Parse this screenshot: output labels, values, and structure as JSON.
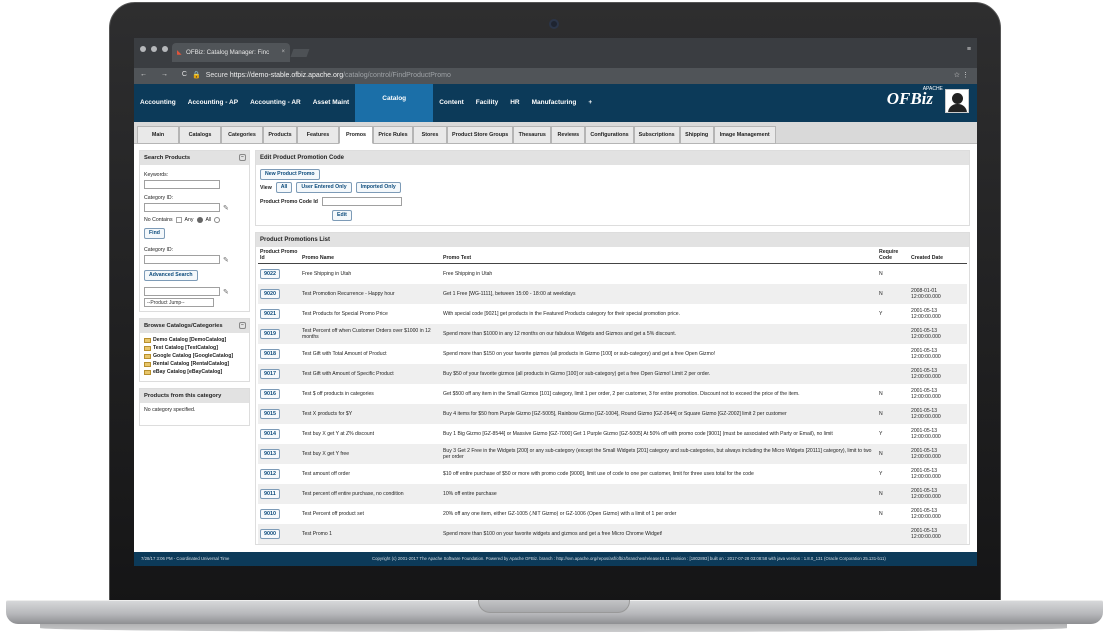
{
  "browser": {
    "tab_title": "OFBiz: Catalog Manager: Finc",
    "secure_label": "Secure",
    "url_host": "https://demo-stable.ofbiz.apache.org",
    "url_path": "/catalog/control/FindProductPromo",
    "nav_glyphs": "← → C"
  },
  "app_nav": {
    "items": [
      "Accounting",
      "Accounting - AP",
      "Accounting - AR",
      "Asset Maint",
      "Catalog",
      "Content",
      "Facility",
      "HR",
      "Manufacturing",
      "+"
    ],
    "selected": "Catalog",
    "logo_text": "OFBiz",
    "logo_small": "APACHE"
  },
  "sub_tabs": {
    "items": [
      "Main",
      "Catalogs",
      "Categories",
      "Products",
      "Features",
      "Promos",
      "Price Rules",
      "Stores",
      "Product Store Groups",
      "Thesaurus",
      "Reviews",
      "Configurations",
      "Subscriptions",
      "Shipping",
      "Image Management"
    ],
    "selected": "Promos"
  },
  "search": {
    "title": "Search Products",
    "keywords_label": "Keywords:",
    "category_label": "Category ID:",
    "no_contains_label": "No Contains",
    "any_label": "Any",
    "all_label": "All",
    "find_label": "Find",
    "category_label2": "Category ID:",
    "advanced_label": "Advanced Search",
    "jump_label": "--Product Jump--"
  },
  "browse": {
    "title": "Browse Catalogs/Categories",
    "items": [
      "Demo Catalog [DemoCatalog]",
      "Test Catalog [TestCatalog]",
      "Google Catalog [GoogleCatalog]",
      "Rental Catalog [RentalCatalog]",
      "eBay Catalog [eBayCatalog]"
    ]
  },
  "products_cat": {
    "title": "Products from this category",
    "empty": "No category specified."
  },
  "edit": {
    "title": "Edit Product Promotion Code",
    "new_label": "New Product Promo",
    "view_label": "View",
    "all_label": "All",
    "user_label": "User Entered Only",
    "imported_label": "Imported Only",
    "code_label": "Product Promo Code Id",
    "edit_label": "Edit"
  },
  "list": {
    "title": "Product Promotions List",
    "headers": {
      "id": "Product Promo Id",
      "name": "Promo Name",
      "text": "Promo Text",
      "req": "Require Code",
      "created": "Created Date"
    },
    "rows": [
      {
        "id": "9022",
        "name": "Free Shipping in Utah",
        "text": "Free Shipping in Utah",
        "req": "N",
        "date": "",
        "time": ""
      },
      {
        "id": "9020",
        "name": "Test Promotion Recurrence - Happy hour",
        "text": "Get 1 Free [WG-1111], between 15:00 - 18:00 at weekdays",
        "req": "N",
        "date": "2008-01-01",
        "time": "12:00:00.000"
      },
      {
        "id": "9021",
        "name": "Test Products for Special Promo Price",
        "text": "With special code [9021] get products in the Featured Products category for their special promotion price.",
        "req": "Y",
        "date": "2001-05-13",
        "time": "12:00:00.000"
      },
      {
        "id": "9019",
        "name": "Test Percent off when Customer Orders over $1000 in 12 months",
        "text": "Spend more than $1000 in any 12 months on our fabulous Widgets and Gizmos and get a 5% discount.",
        "req": "",
        "date": "2001-05-13",
        "time": "12:00:00.000"
      },
      {
        "id": "9018",
        "name": "Test Gift with Total Amount of Product",
        "text": "Spend more than $150 on your favorite gizmos (all products in Gizmo [100] or sub-category) and get a free Open Gizmo!",
        "req": "",
        "date": "2001-05-13",
        "time": "12:00:00.000"
      },
      {
        "id": "9017",
        "name": "Test Gift with Amount of Specific Product",
        "text": "Buy $50 of your favorite gizmos (all products in Gizmo [100] or sub-category) get a free Open Gizmo! Limit 2 per order.",
        "req": "",
        "date": "2001-05-13",
        "time": "12:00:00.000"
      },
      {
        "id": "9016",
        "name": "Test $ off products in categories",
        "text": "Get $500 off any item in the Small Gizmos [101] category, limit 1 per order, 2 per customer, 3 for entire promotion. Discount not to exceed the price of the item.",
        "req": "N",
        "date": "2001-05-13",
        "time": "12:00:00.000"
      },
      {
        "id": "9015",
        "name": "Test X products for $Y",
        "text": "Buy 4 items for $50 from Purple Gizmo [GZ-5005], Rainbow Gizmo [GZ-1004], Round Gizmo [GZ-2644] or Square Gizmo [GZ-2002] limit 2 per customer",
        "req": "N",
        "date": "2001-05-13",
        "time": "12:00:00.000"
      },
      {
        "id": "9014",
        "name": "Test buy X get Y at Z% discount",
        "text": "Buy 1 Big Gizmo [GZ-8544] or Massive Gizmo [GZ-7000] Get 1 Purple Gizmo [GZ-5005] At 50% off with promo code [9001] (must be associated with Party or Email), no limit",
        "req": "Y",
        "date": "2001-05-13",
        "time": "12:00:00.000"
      },
      {
        "id": "9013",
        "name": "Test buy X get Y free",
        "text": "Buy 3 Get 2 Free in the Widgets [200] or any sub-category (except the Small Widgets [201] category and sub-categories, but always including the Micro Widgets [20111] category), limit to two per order",
        "req": "N",
        "date": "2001-05-13",
        "time": "12:00:00.000"
      },
      {
        "id": "9012",
        "name": "Test amount off order",
        "text": "$10 off entire purchase of $50 or more with promo code [9000], limit use of code to one per customer, limit for three uses total for the code",
        "req": "Y",
        "date": "2001-05-13",
        "time": "12:00:00.000"
      },
      {
        "id": "9011",
        "name": "Test percent off entire purchase, no condition",
        "text": "10% off entire purchase",
        "req": "N",
        "date": "2001-05-13",
        "time": "12:00:00.000"
      },
      {
        "id": "9010",
        "name": "Test Percent off product set",
        "text": "20% off any one item, either GZ-1005 (.NIT Gizmo) or GZ-1006 (Open Gizmo) with a limit of 1 per order",
        "req": "N",
        "date": "2001-05-13",
        "time": "12:00:00.000"
      },
      {
        "id": "9000",
        "name": "Test Promo 1",
        "text": "Spend more than $100 on your favorite widgets and gizmos and get a free Micro Chrome Widget!",
        "req": "",
        "date": "2001-05-13",
        "time": "12:00:00.000"
      }
    ]
  },
  "footer": {
    "time": "7/28/17 3:06 PM - Coordinated Universal Time",
    "copyright": "Copyright (c) 2001-2017 The Apache Software Foundation. Powered by Apache OFBiz. branch : http://svn.apache.org/repos/asf/ofbiz/branches/release16.11 revision : [1802893] built on : 2017-07-28 03:08:58 with java version : 1.8.0_131 (Oracle Corporation 25.131-b11)"
  },
  "colors": {
    "nav_bg": "#0c3a59",
    "selected_nav": "#1b6fa8",
    "link": "#0c4b7c"
  }
}
